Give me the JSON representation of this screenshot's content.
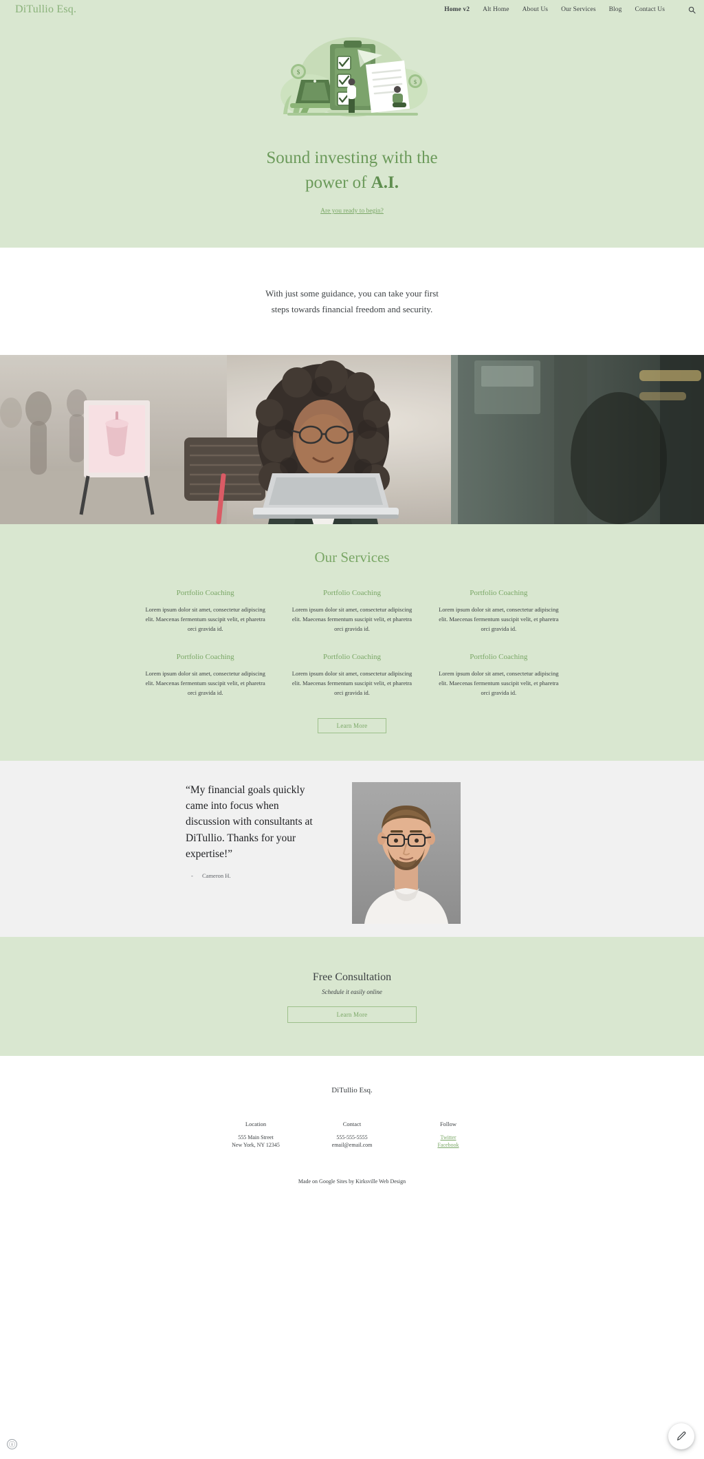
{
  "site": {
    "brand": "DiTullio Esq.",
    "accent_green": "#7aa766",
    "hero_bg": "#d9e7d0",
    "band_bg": "#f1f1f1"
  },
  "nav": {
    "items": [
      {
        "label": "Home v2",
        "active": true
      },
      {
        "label": "Alt Home",
        "active": false
      },
      {
        "label": "About Us",
        "active": false
      },
      {
        "label": "Our Services",
        "active": false
      },
      {
        "label": "Blog",
        "active": false
      },
      {
        "label": "Contact Us",
        "active": false
      }
    ],
    "search_icon": "search-icon"
  },
  "hero": {
    "illustration": "checklist-finance-illustration",
    "title_line1": "Sound investing with the",
    "title_line2_prefix": "power of ",
    "title_line2_bold": "A.I.",
    "cta": "Are you ready to begin?"
  },
  "intro": {
    "line1": "With just some guidance, you can take your first",
    "line2": "steps towards financial freedom and security."
  },
  "photo_band": {
    "alt": "woman-working-on-laptop-at-outdoor-cafe"
  },
  "services": {
    "title": "Our Services",
    "cards": [
      {
        "title": "Portfolio Coaching",
        "body": "Lorem ipsum dolor sit amet, consectetur adipiscing elit. Maecenas fermentum suscipit velit, et pharetra orci gravida id."
      },
      {
        "title": "Portfolio Coaching",
        "body": "Lorem ipsum dolor sit amet, consectetur adipiscing elit. Maecenas fermentum suscipit velit, et pharetra orci gravida id."
      },
      {
        "title": "Portfolio Coaching",
        "body": "Lorem ipsum dolor sit amet, consectetur adipiscing elit. Maecenas fermentum suscipit velit, et pharetra orci gravida id."
      },
      {
        "title": "Portfolio Coaching",
        "body": "Lorem ipsum dolor sit amet, consectetur adipiscing elit. Maecenas fermentum suscipit velit, et pharetra orci gravida id."
      },
      {
        "title": "Portfolio Coaching",
        "body": "Lorem ipsum dolor sit amet, consectetur adipiscing elit. Maecenas fermentum suscipit velit, et pharetra orci gravida id."
      },
      {
        "title": "Portfolio Coaching",
        "body": "Lorem ipsum dolor sit amet, consectetur adipiscing elit. Maecenas fermentum suscipit velit, et pharetra orci gravida id."
      }
    ],
    "button": "Learn More"
  },
  "testimonial": {
    "quote": "“My financial goals quickly came into focus when discussion with consultants at DiTullio. Thanks for your expertise!”",
    "attribution": "Cameron H.",
    "portrait_alt": "portrait-of-man-with-glasses"
  },
  "consult": {
    "title": "Free Consultation",
    "subtitle": "Schedule it easily online",
    "button": "Learn More"
  },
  "footer": {
    "brand": "DiTullio Esq.",
    "columns": [
      {
        "title": "Location",
        "lines": [
          "555 Main Street",
          "New York, NY 12345"
        ],
        "links": []
      },
      {
        "title": "Contact",
        "lines": [
          "555-555-5555",
          "email@email.com"
        ],
        "links": []
      },
      {
        "title": "Follow",
        "lines": [],
        "links": [
          "Twitter",
          "Facebook"
        ]
      }
    ],
    "credit": "Made on Google Sites by Kirksville Web Design"
  },
  "floating": {
    "info_glyph": "ⓘ",
    "info_name": "info-icon",
    "edit_name": "edit-pencil-icon"
  }
}
